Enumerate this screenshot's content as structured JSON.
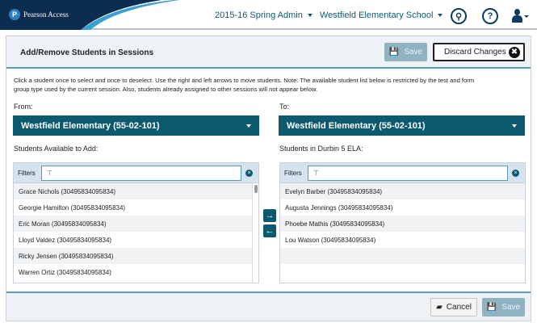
{
  "header": {
    "brand": "Pearson Access",
    "admin": "2015-16 Spring Admin",
    "school": "Westfield Elementary School",
    "icons": [
      "search-icon",
      "help-icon",
      "user-icon"
    ]
  },
  "panel": {
    "title": "Add/Remove Students in Sessions",
    "save_label": "Save",
    "discard_label": "Discard Changes",
    "instructions": "Click a student once to select and once to deselect. Use the right and left arrows to move students. Note: The available student list below is restricted by the test and form group type used by the current session. Also, students already assigned to other sessions will not appear below."
  },
  "from": {
    "label": "From:",
    "selected": "Westfield Elementary (55-02-101)",
    "list_title": "Students Available to Add:",
    "filters_label": "Filters",
    "students": [
      "Grace Nichols  (30495834095834)",
      "Georgie Hamilton (30495834095834)",
      "Eric Moran (30495834095834)",
      "Lloyd Valdez (30495834095834)",
      "Ricky Jensen (30495834095834)",
      "Warren Ortiz (30495834095834)"
    ]
  },
  "to": {
    "label": "To:",
    "selected": "Westfield Elementary (55-02-101)",
    "list_title": "Students in Durbin 5 ELA:",
    "filters_label": "Filters",
    "students": [
      "Evelyn Barber (30495834095834)",
      "Augusta Jennings (30495834095834)",
      "Phoebe Mathis (30495834095834)",
      "Lou Watson (30495834095834)"
    ]
  },
  "footer": {
    "cancel_label": "Cancel",
    "save_label": "Save"
  },
  "colors": {
    "primary": "#0d5a6e",
    "navy": "#0d2d50",
    "disabled_save": "#8fb3c0"
  }
}
